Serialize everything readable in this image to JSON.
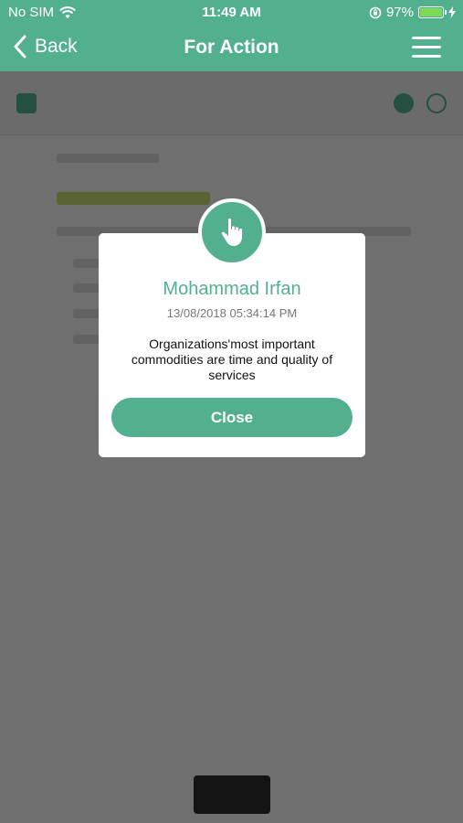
{
  "status_bar": {
    "carrier": "No SIM",
    "time": "11:49 AM",
    "battery": "97%",
    "battery_level": 0.97,
    "icons": [
      "wifi-icon",
      "orientation-lock-icon",
      "battery-icon",
      "charging-icon"
    ]
  },
  "nav": {
    "back_label": "Back",
    "title": "For Action",
    "menu_icon": "hamburger-menu-icon"
  },
  "modal": {
    "icon": "pointing-hand-icon",
    "name": "Mohammad Irfan",
    "timestamp": "13/08/2018 05:34:14 PM",
    "message": "Organizations'most important commodities are time and quality of services",
    "close_label": "Close"
  },
  "colors": {
    "accent": "#52b08e",
    "overlay": "rgba(0,0,0,0.55)"
  }
}
